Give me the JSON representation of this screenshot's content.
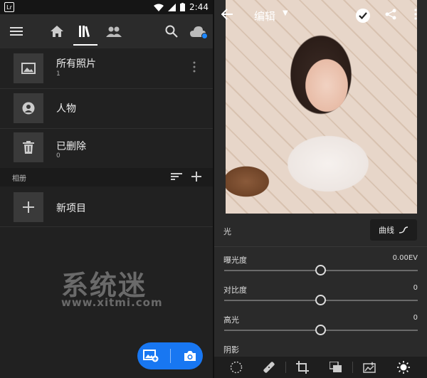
{
  "status_bar": {
    "app_badge": "Lr",
    "time": "2:44"
  },
  "library": {
    "items": [
      {
        "title": "所有照片",
        "count": "1"
      },
      {
        "title": "人物",
        "count": ""
      },
      {
        "title": "已删除",
        "count": "0"
      }
    ],
    "albums_header": "相册",
    "new_item": "新项目"
  },
  "watermark": {
    "main": "系统迷",
    "sub": "www.xitmi.com"
  },
  "editor": {
    "title": "编辑",
    "section_label": "光",
    "curve_button": "曲线",
    "sliders": [
      {
        "name": "曝光度",
        "value": "0.00EV"
      },
      {
        "name": "对比度",
        "value": "0"
      },
      {
        "name": "高光",
        "value": "0"
      },
      {
        "name": "阴影",
        "value": ""
      }
    ]
  },
  "colors": {
    "accent": "#1877f2",
    "cloud_dot": "#1e88ff",
    "background": "#212121"
  }
}
